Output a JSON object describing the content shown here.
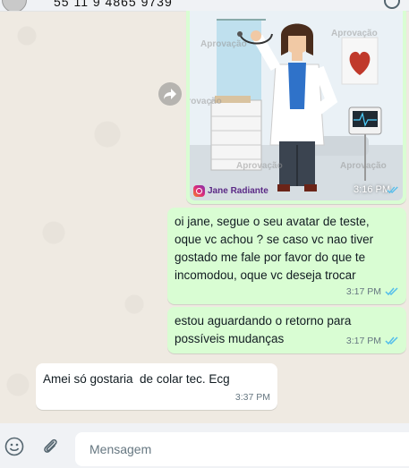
{
  "header": {
    "contact_phone": "55 11 9 4865 9739",
    "avatar_icon": "avatar",
    "search_icon": "search-icon"
  },
  "forward": {
    "icon": "forward-icon"
  },
  "image_message": {
    "time": "3:16 PM",
    "status_icon": "double-check-icon",
    "status_color": "#53bdeb",
    "instagram_handle": "Jane Radiante",
    "watermark": "Aprovação"
  },
  "messages": [
    {
      "direction": "out",
      "text": "oi jane, segue o seu avatar de teste,\noque vc achou ? se caso vc nao tiver\ngostado me fale por favor do que te\nincomodou, oque vc deseja trocar",
      "time": "3:17 PM",
      "status": "read"
    },
    {
      "direction": "out",
      "text": "estou aguardando o retorno para\npossíveis mudanças",
      "time": "3:17 PM",
      "status": "read"
    },
    {
      "direction": "in",
      "text": "Amei só gostaria  de colar tec. Ecg",
      "time": "3:37 PM"
    }
  ],
  "compose": {
    "placeholder": "Mensagem",
    "value": "",
    "emoji_icon": "emoji-icon",
    "attach_icon": "paperclip-icon"
  },
  "colors": {
    "chat_background": "#efeae2",
    "outgoing_bubble": "#d9fdd3",
    "incoming_bubble": "#ffffff",
    "read_tick": "#53bdeb"
  }
}
